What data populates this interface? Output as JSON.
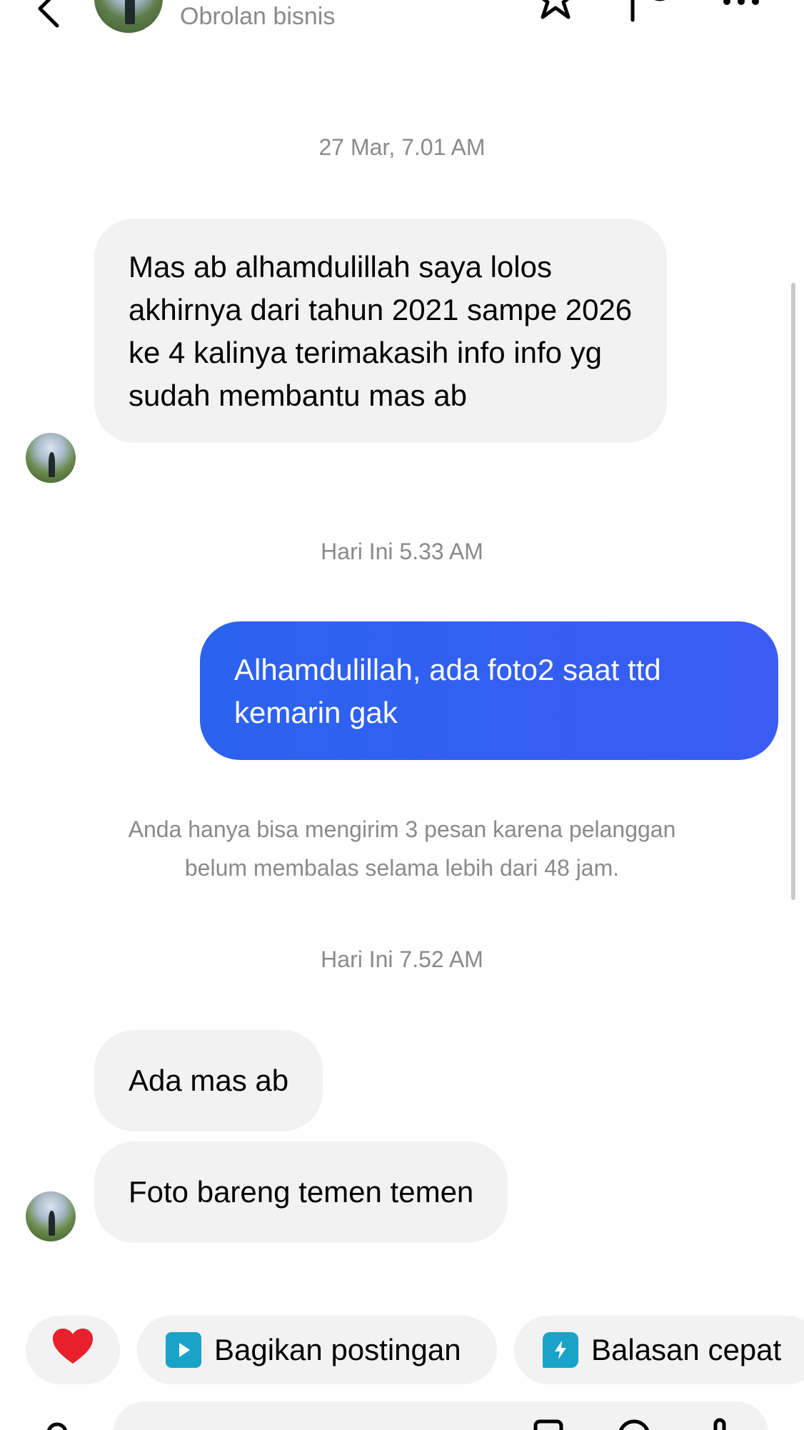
{
  "header": {
    "subtitle": "Obrolan bisnis",
    "icons": [
      "back-arrow-icon",
      "star-icon",
      "flag-icon",
      "more-icon"
    ]
  },
  "messages": [
    {
      "type": "timestamp",
      "text": "27 Mar, 7.01 AM"
    },
    {
      "type": "incoming",
      "text": "Mas ab alhamdulillah saya lolos akhirnya dari tahun 2021 sampe 2026 ke 4 kalinya terimakasih info info yg sudah membantu mas ab"
    },
    {
      "type": "timestamp",
      "text": "Hari Ini 5.33 AM"
    },
    {
      "type": "outgoing",
      "text": "Alhamdulillah, ada foto2 saat ttd kemarin gak"
    },
    {
      "type": "notice",
      "text": "Anda hanya bisa mengirim 3 pesan karena pelanggan belum membalas selama lebih dari 48 jam."
    },
    {
      "type": "timestamp",
      "text": "Hari Ini 7.52 AM"
    },
    {
      "type": "incoming",
      "text": "Ada mas ab"
    },
    {
      "type": "incoming",
      "text": "Foto bareng temen temen"
    }
  ],
  "quick_actions": [
    {
      "icon": "heart-icon",
      "label": ""
    },
    {
      "icon": "share-post-icon",
      "label": "Bagikan postingan"
    },
    {
      "icon": "quick-reply-icon",
      "label": "Balasan cepat"
    }
  ],
  "colors": {
    "outgoing_bubble": "#2f61f0",
    "incoming_bubble": "#f2f2f2",
    "meta_text": "#8a8a8a",
    "heart": "#e8202d",
    "chip_icon": "#1aa3c9"
  }
}
